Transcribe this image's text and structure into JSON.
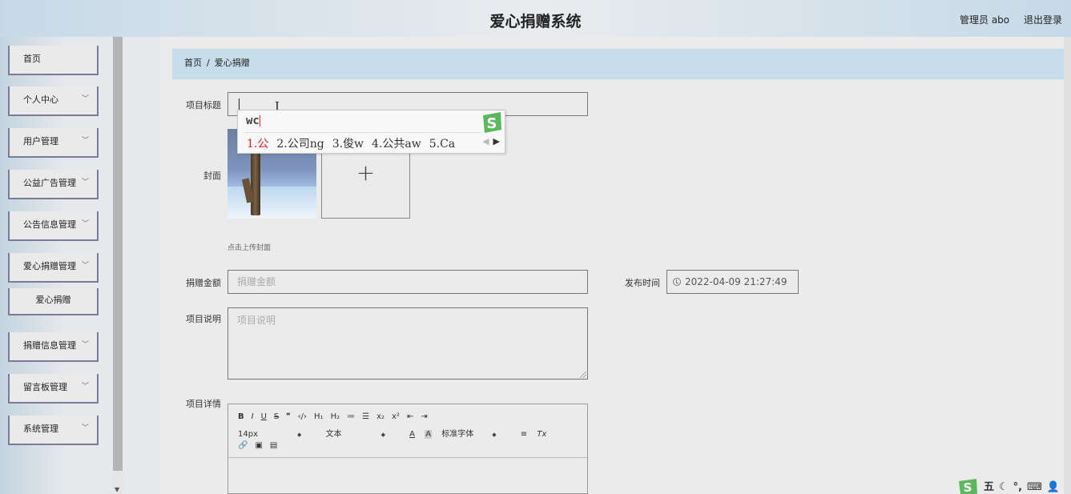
{
  "header": {
    "title": "爱心捐赠系统",
    "user_label": "管理员 abo",
    "logout_label": "退出登录"
  },
  "sidebar": {
    "items": [
      {
        "label": "首页",
        "expandable": false
      },
      {
        "label": "个人中心",
        "expandable": true
      },
      {
        "label": "用户管理",
        "expandable": true
      },
      {
        "label": "公益广告管理",
        "expandable": true
      },
      {
        "label": "公告信息管理",
        "expandable": true
      },
      {
        "label": "爱心捐赠管理",
        "expandable": true
      },
      {
        "label": "爱心捐赠",
        "expandable": false,
        "sub": true
      },
      {
        "label": "捐赠信息管理",
        "expandable": true
      },
      {
        "label": "留言板管理",
        "expandable": true
      },
      {
        "label": "系统管理",
        "expandable": true
      }
    ]
  },
  "breadcrumb": {
    "home": "首页",
    "separator": "/",
    "current": "爱心捐赠"
  },
  "form": {
    "title_label": "项目标题",
    "title_value": "",
    "cover_label": "封面",
    "cover_hint": "点击上传封面",
    "upload_plus": "+",
    "amount_label": "捐赠金额",
    "amount_placeholder": "捐赠金额",
    "publish_time_label": "发布时间",
    "publish_time_value": "2022-04-09 21:27:49",
    "description_label": "项目说明",
    "description_placeholder": "项目说明",
    "details_label": "项目详情"
  },
  "editor": {
    "row1": [
      "B",
      "I",
      "U",
      "S",
      "❞",
      "‹/›",
      "H₁",
      "H₂",
      "≔",
      "☰",
      "x₂",
      "x²",
      "⇤",
      "⇥"
    ],
    "font_size": "14px",
    "text_style": "文本",
    "color_a": "A",
    "bg_a": "A",
    "font_family": "标准字体",
    "align": "≡",
    "clear": "Tx",
    "row3": [
      "🔗",
      "▣",
      "▤"
    ]
  },
  "ime": {
    "composition": "wc",
    "candidates": [
      "1.公",
      "2.公司ng",
      "3.俊w",
      "4.公共aw",
      "5.Ca"
    ],
    "prev": "◀",
    "next": "▶"
  },
  "tray": {
    "items": [
      "五",
      "☾",
      "°,",
      "⌨",
      "👤"
    ]
  },
  "colors": {
    "accent_header": "#c6d9e8",
    "breadcrumb_bg": "#c6dceb",
    "ime_highlight": "#d32020",
    "sogou_green": "#5cb85c"
  }
}
